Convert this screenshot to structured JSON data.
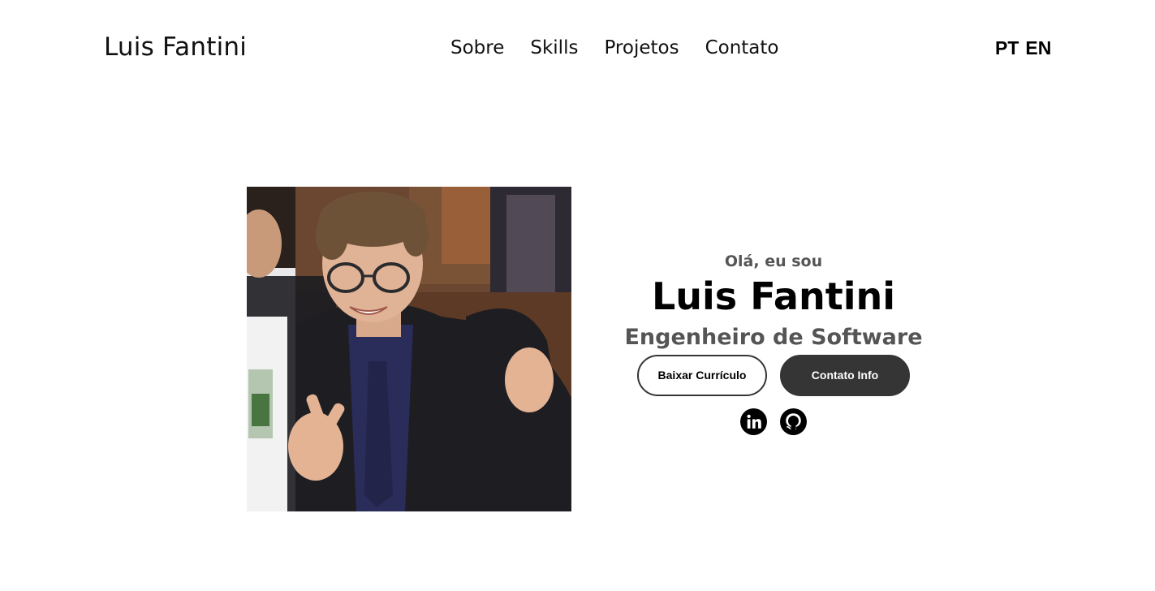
{
  "nav": {
    "logo": "Luis Fantini",
    "links": [
      "Sobre",
      "Skills",
      "Projetos",
      "Contato"
    ],
    "languages": [
      "PT",
      "EN"
    ]
  },
  "hero": {
    "greeting": "Olá, eu sou",
    "name": "Luis Fantini",
    "role": "Engenheiro de Software",
    "buttons": {
      "cv": "Baixar Currículo",
      "contact": "Contato Info"
    },
    "profile_image_alt": "profile-photo",
    "socials": [
      "linkedin-icon",
      "github-icon"
    ]
  },
  "colors": {
    "text": "#000000",
    "muted": "#555555",
    "button_dark": "#353535",
    "background": "#ffffff"
  }
}
